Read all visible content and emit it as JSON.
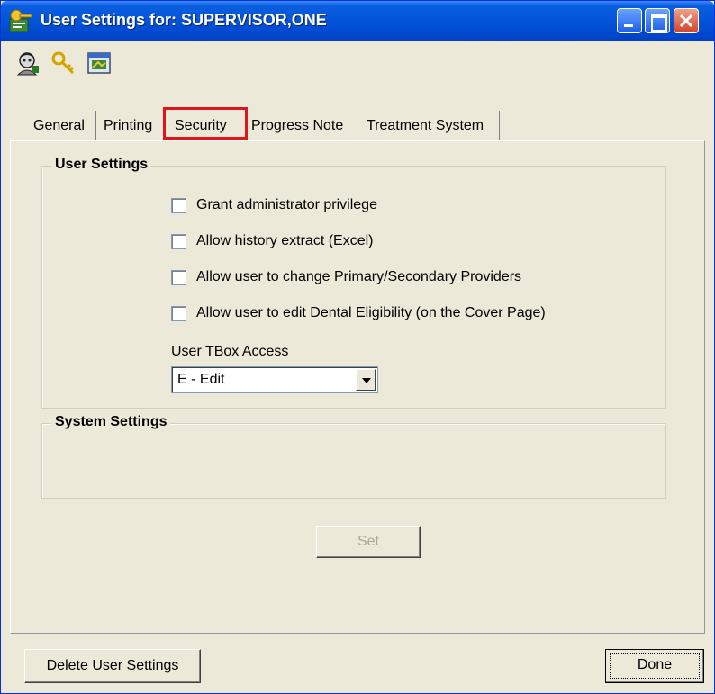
{
  "window": {
    "title": "User Settings for: SUPERVISOR,ONE"
  },
  "toolbar": {
    "icons": [
      "user-icon",
      "key-icon",
      "window-icon"
    ]
  },
  "tabs": [
    {
      "label": "General",
      "active": false
    },
    {
      "label": "Printing",
      "active": false
    },
    {
      "label": "Security",
      "active": true
    },
    {
      "label": "Progress Note",
      "active": false
    },
    {
      "label": "Treatment System",
      "active": false
    }
  ],
  "user_settings": {
    "legend": "User Settings",
    "checkboxes": [
      {
        "label": "Grant administrator privilege",
        "checked": false
      },
      {
        "label": "Allow history extract (Excel)",
        "checked": false
      },
      {
        "label": "Allow user to change Primary/Secondary Providers",
        "checked": false
      },
      {
        "label": "Allow user to edit Dental Eligibility (on the Cover Page)",
        "checked": false
      }
    ],
    "tbox_access_label": "User TBox Access",
    "tbox_access_value": "E - Edit"
  },
  "system_settings": {
    "legend": "System Settings"
  },
  "buttons": {
    "set": "Set",
    "delete": "Delete User Settings",
    "done": "Done"
  },
  "colors": {
    "active_tab_highlight": "#e0141c",
    "titlebar": "#0252d8"
  }
}
